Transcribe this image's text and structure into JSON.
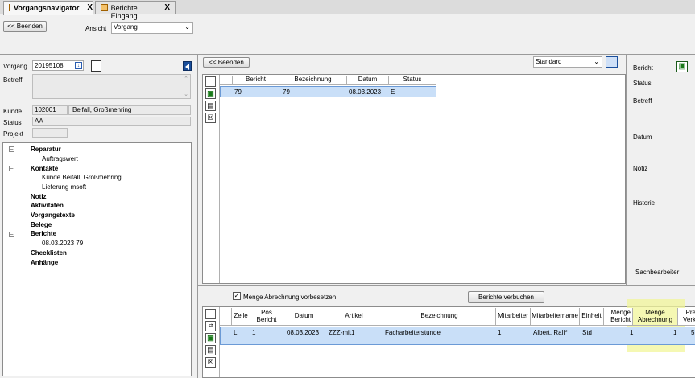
{
  "tabs": [
    {
      "label": "Vorgangsnavigator",
      "close": "X"
    },
    {
      "label": "Berichte Eingang",
      "close": "X"
    }
  ],
  "toolbar": {
    "back_label": "<< Beenden",
    "ansicht_label": "Ansicht",
    "ansicht_value": "Vorgang"
  },
  "left": {
    "vorgang_label": "Vorgang",
    "vorgang_value": "20195108",
    "betreff_label": "Betreff",
    "kunde_label": "Kunde",
    "kunde_nr": "102001",
    "kunde_name": "Beifall, Großmehring",
    "status_label": "Status",
    "status_value": "AA",
    "projekt_label": "Projekt",
    "tree": {
      "reparatur": "Reparatur",
      "auftragswert": "Auftragswert",
      "kontakte": "Kontakte",
      "kontakt_kunde": "Kunde  Beifall, Großmehring",
      "kontakt_lieferung": "Lieferung  msoft",
      "notiz": "Notiz",
      "aktivitaeten": "Aktivitäten",
      "vorgangstexte": "Vorgangstexte",
      "belege": "Belege",
      "berichte": "Berichte",
      "bericht_entry": "08.03.2023  79",
      "checklisten": "Checklisten",
      "anhaenge": "Anhänge"
    }
  },
  "middle": {
    "back_label": "<< Beenden",
    "layout_select": "Standard",
    "columns": [
      "Bericht",
      "Bezeichnung",
      "Datum",
      "Status"
    ],
    "rows": [
      [
        "79",
        "79",
        "08.03.2023",
        "E"
      ]
    ]
  },
  "right": {
    "labels": [
      "Bericht",
      "Status",
      "Betreff",
      "Datum",
      "Notiz",
      "Historie",
      "Sachbearbeiter"
    ]
  },
  "bottom": {
    "checkbox_label": "Menge Abrechnung vorbesetzen",
    "checkbox_checked": true,
    "verbuchen_label": "Berichte verbuchen",
    "columns": [
      "Zeile",
      "Pos Bericht",
      "Datum",
      "Artikel",
      "Bezeichnung",
      "Mitarbeiter",
      "Mitarbeitername",
      "Einheit",
      "Menge Bericht",
      "Menge Abrechnung",
      "Pre Verk"
    ],
    "rows": [
      [
        "L",
        "1",
        "08.03.2023",
        "ZZZ-mit1",
        "Facharbeiterstunde",
        "1",
        "Albert, Ralf*",
        "Std",
        "1",
        "1",
        "5"
      ]
    ]
  },
  "colors": {
    "selection": "#c9dff8",
    "highlight": "#f1f59a",
    "accent": "#1a4f9c"
  }
}
